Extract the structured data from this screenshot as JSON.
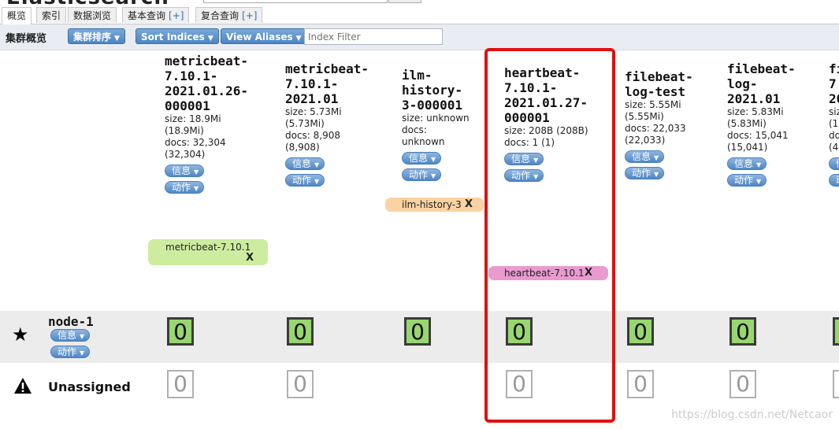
{
  "tabs": [
    {
      "label": "概览"
    },
    {
      "label": "索引"
    },
    {
      "label": "数据浏览"
    },
    {
      "label": "基本查询",
      "plus": "[+]"
    },
    {
      "label": "复合查询",
      "plus": "[+]"
    }
  ],
  "toolbar": {
    "title": "集群概览",
    "sort_cluster": "集群排序",
    "sort_indices": "Sort Indices",
    "view_aliases": "View Aliases",
    "filter_placeholder": "Index Filter",
    "caret": "▼"
  },
  "pill_labels": {
    "info": "信息",
    "action": "动作"
  },
  "indices": [
    {
      "name": "metricbeat-\n7.10.1-\n2021.01.26-\n000001",
      "meta": "size: 18.9Mi\n(18.9Mi)\ndocs: 32,304\n(32,304)"
    },
    {
      "name": "metricbeat-\n7.10.1-\n2021.01",
      "meta": "size: 5.73Mi\n(5.73Mi)\ndocs: 8,908\n(8,908)"
    },
    {
      "name": "ilm-\nhistory-\n3-000001",
      "meta": "size: unknown\ndocs:\nunknown"
    },
    {
      "name": "heartbeat-\n7.10.1-\n2021.01.27-\n000001",
      "meta": "size: 208B (208B)\ndocs: 1 (1)"
    },
    {
      "name": "filebeat-\nlog-test",
      "meta": "size: 5.55Mi\n(5.55Mi)\ndocs: 22,033\n(22,033)"
    },
    {
      "name": "filebeat-\nlog-\n2021.01",
      "meta": "size: 5.83Mi\n(5.83Mi)\ndocs: 15,041\n(15,041)"
    },
    {
      "name": "fi\n7.\n20",
      "meta": "size\n(1\ndoc\n(4"
    }
  ],
  "aliases": [
    {
      "label": "metricbeat-7.10.1",
      "close": "X",
      "color": "#cdeca0"
    },
    {
      "label": "ilm-history-3",
      "close": "X",
      "color": "#fbd2a1"
    },
    {
      "label": "heartbeat-7.10.1",
      "close": "X",
      "color": "#e99bd0"
    }
  ],
  "rows": {
    "node": {
      "name": "node-1",
      "shard_values": [
        "0",
        "0",
        "0",
        "0",
        "0",
        "0"
      ]
    },
    "unassigned": {
      "name": "Unassigned",
      "shard_values": [
        "0",
        "0",
        "0",
        "0",
        "0",
        "0"
      ]
    }
  },
  "watermark": "https://blog.csdn.net/Netcaor",
  "icons": {
    "node": "star-icon",
    "unassigned": "warning-icon",
    "caret": "chevron-down-icon"
  },
  "colors": {
    "shard_assigned": "#98d76f",
    "highlight": "#e01010",
    "toolbar_button": "#4d86c4"
  }
}
